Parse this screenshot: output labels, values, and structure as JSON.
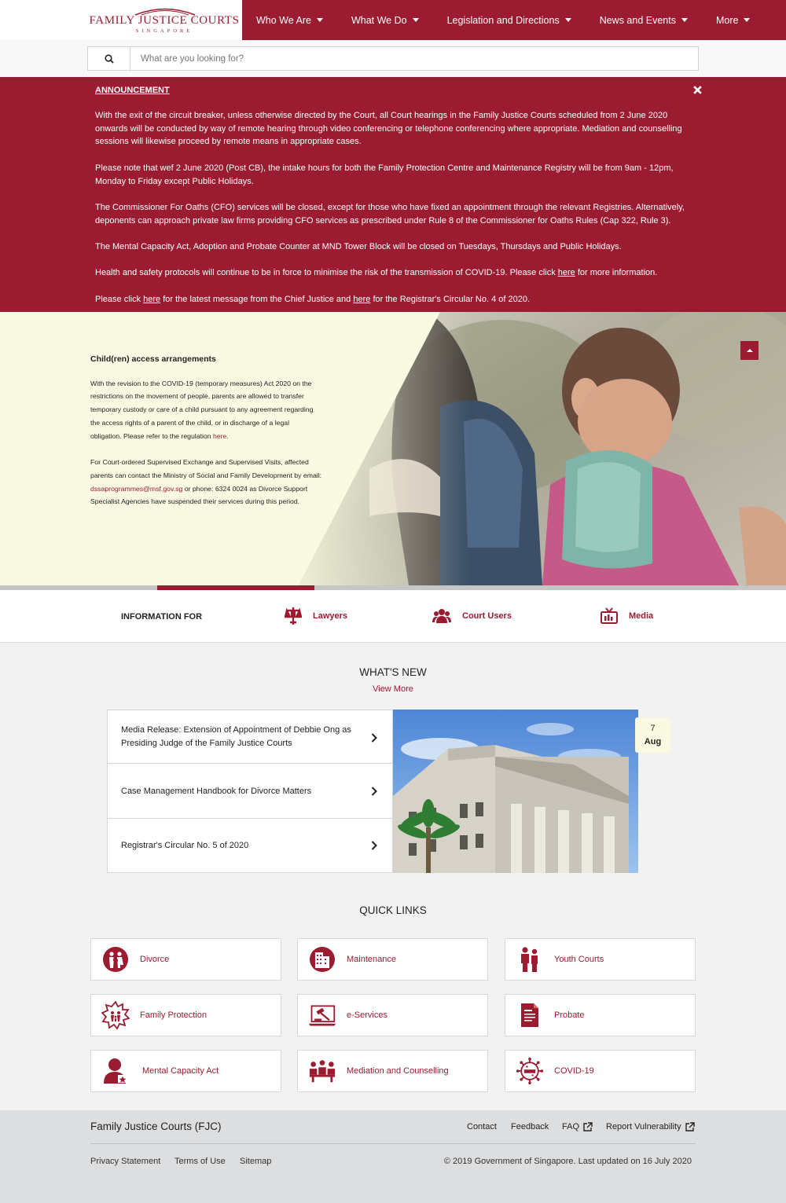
{
  "brand": {
    "name": "FAMILY JUSTICE COURTS",
    "sub": "SINGAPORE"
  },
  "nav": {
    "items": [
      {
        "label": "Who We Are"
      },
      {
        "label": "What We Do"
      },
      {
        "label": "Legislation and Directions"
      },
      {
        "label": "News and Events"
      },
      {
        "label": "More"
      }
    ]
  },
  "search": {
    "placeholder": "What are you looking for?",
    "value": ""
  },
  "announcement": {
    "title": "ANNOUNCEMENT",
    "p1": "With the exit of the circuit breaker, unless otherwise directed by the Court, all Court hearings in the Family Justice Courts scheduled from 2 June 2020 onwards will be conducted by way of remote hearing through video conferencing or telephone conferencing where appropriate. Mediation and counselling sessions will likewise proceed by remote means in appropriate cases.",
    "p2": "Please note that wef 2 June 2020 (Post CB), the intake hours for both the Family Protection Centre and Maintenance Registry will be from 9am - 12pm, Monday to Friday except Public Holidays.",
    "p3": "The Commissioner For Oaths (CFO) services will be closed, except for those who have fixed an appointment through the relevant Registries. Alternatively, deponents can approach private law firms providing CFO services as prescribed under Rule 8 of the Commissioner for Oaths Rules (Cap 322, Rule 3).",
    "p4": "The Mental Capacity Act, Adoption and Probate Counter at MND Tower Block will be closed on Tuesdays, Thursdays and Public Holidays.",
    "p5_a": "Health and safety protocols will continue to be in force to minimise the risk of the transmission of COVID-19. Please click ",
    "p5_link": "here",
    "p5_b": " for more information.",
    "p6_a": "Please click ",
    "p6_link1": "here",
    "p6_b": " for the latest message from the Chief Justice and ",
    "p6_link2": "here",
    "p6_c": " for the Registrar's Circular No. 4 of 2020."
  },
  "hero": {
    "title": "Child(ren) access arrangements",
    "p1_a": "With the revision to the COVID-19 (temporary measures) Act 2020 on the restrictions on the movement of people, parents are allowed to transfer temporary custody or care of a child pursuant to any agreement regarding the access rights of a parent of the child, or in discharge of a legal obligation. Please refer to the regulation ",
    "p1_link": "here",
    "p1_b": ".",
    "p2_a": "For Court-ordered Supervised Exchange and Supervised Visits, affected parents can contact the Ministry of Social and Family Development by email: ",
    "p2_email": "dssaprogrammes@msf.gov.sg",
    "p2_b": "  or phone: 6324 0024 as Divorce Support Specialist Agencies have suspended their services during this period."
  },
  "info_for": {
    "label": "INFORMATION FOR",
    "links": [
      {
        "label": "Lawyers",
        "icon": "lawyer-icon"
      },
      {
        "label": "Court Users",
        "icon": "users-icon"
      },
      {
        "label": "Media",
        "icon": "tv-icon"
      }
    ]
  },
  "whats_new": {
    "title": "WHAT'S NEW",
    "view_more": "View More",
    "items": [
      {
        "label": "Media Release: Extension of Appointment of Debbie Ong as Presiding Judge of the Family Justice Courts"
      },
      {
        "label": "Case Management Handbook for Divorce Matters"
      },
      {
        "label": "Registrar's Circular No. 5 of 2020"
      }
    ],
    "date_day": "7",
    "date_month": "Aug"
  },
  "quick_links": {
    "title": "QUICK LINKS",
    "items": [
      {
        "label": "Divorce",
        "icon": "divorce-icon"
      },
      {
        "label": "Maintenance",
        "icon": "maintenance-icon"
      },
      {
        "label": "Youth Courts",
        "icon": "youth-courts-icon"
      },
      {
        "label": "Family Protection",
        "icon": "family-protection-icon"
      },
      {
        "label": "e-Services",
        "icon": "eservices-icon"
      },
      {
        "label": "Probate",
        "icon": "probate-icon"
      },
      {
        "label": "Mental Capacity Act",
        "icon": "mental-capacity-icon"
      },
      {
        "label": "Mediation and Counselling",
        "icon": "mediation-icon"
      },
      {
        "label": "COVID-19",
        "icon": "covid-icon"
      }
    ]
  },
  "footer": {
    "title": "Family Justice Courts (FJC)",
    "links": [
      {
        "label": "Contact"
      },
      {
        "label": "Feedback"
      },
      {
        "label": "FAQ"
      },
      {
        "label": "Report Vulnerability"
      }
    ],
    "bottom_links": [
      {
        "label": "Privacy Statement"
      },
      {
        "label": "Terms of Use"
      },
      {
        "label": "Sitemap"
      }
    ],
    "copyright": "© 2019 Government of Singapore. Last updated on 16 July 2020"
  },
  "colors": {
    "brand": "#9b1b30",
    "hero_bg": "#fafae2",
    "footer_bg": "#dcdee0"
  }
}
